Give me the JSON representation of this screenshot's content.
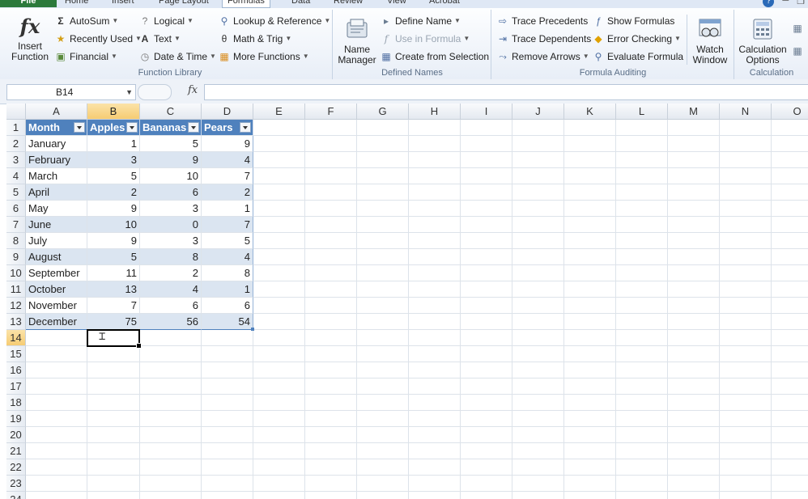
{
  "tabs": {
    "file": "File",
    "home": "Home",
    "insert": "Insert",
    "page_layout": "Page Layout",
    "formulas": "Formulas",
    "data": "Data",
    "review": "Review",
    "view": "View",
    "acrobat": "Acrobat"
  },
  "ribbon": {
    "function_library": {
      "label": "Function Library",
      "insert_function": "Insert Function",
      "autosum": "AutoSum",
      "recently_used": "Recently Used",
      "financial": "Financial",
      "logical": "Logical",
      "text": "Text",
      "date_time": "Date & Time",
      "lookup_reference": "Lookup & Reference",
      "math_trig": "Math & Trig",
      "more_functions": "More Functions"
    },
    "defined_names": {
      "label": "Defined Names",
      "name_manager": "Name Manager",
      "define_name": "Define Name",
      "use_in_formula": "Use in Formula",
      "create_from_selection": "Create from Selection"
    },
    "formula_auditing": {
      "label": "Formula Auditing",
      "trace_precedents": "Trace Precedents",
      "trace_dependents": "Trace Dependents",
      "remove_arrows": "Remove Arrows",
      "show_formulas": "Show Formulas",
      "error_checking": "Error Checking",
      "evaluate_formula": "Evaluate Formula",
      "watch_window": "Watch Window"
    },
    "calculation": {
      "label": "Calculation",
      "calculation_options": "Calculation Options"
    }
  },
  "formula_bar": {
    "name_box": "B14",
    "fx": "fx",
    "value": ""
  },
  "grid": {
    "columns": [
      "A",
      "B",
      "C",
      "D",
      "E",
      "F",
      "G",
      "H",
      "I",
      "J",
      "K",
      "L",
      "M",
      "N",
      "O"
    ],
    "selected_column": "B",
    "rows": [
      "1",
      "2",
      "3",
      "4",
      "5",
      "6",
      "7",
      "8",
      "9",
      "10",
      "11",
      "12",
      "13",
      "14",
      "15",
      "16",
      "17",
      "18",
      "19",
      "20",
      "21",
      "22",
      "23",
      "24"
    ],
    "selected_row": "14",
    "table": {
      "headers": [
        "Month",
        "Apples",
        "Bananas",
        "Pears"
      ],
      "rows": [
        [
          "January",
          "1",
          "5",
          "9"
        ],
        [
          "February",
          "3",
          "9",
          "4"
        ],
        [
          "March",
          "5",
          "10",
          "7"
        ],
        [
          "April",
          "2",
          "6",
          "2"
        ],
        [
          "May",
          "9",
          "3",
          "1"
        ],
        [
          "June",
          "10",
          "0",
          "7"
        ],
        [
          "July",
          "9",
          "3",
          "5"
        ],
        [
          "August",
          "5",
          "8",
          "4"
        ],
        [
          "September",
          "11",
          "2",
          "8"
        ],
        [
          "October",
          "13",
          "4",
          "1"
        ],
        [
          "November",
          "7",
          "6",
          "6"
        ],
        [
          "December",
          "75",
          "56",
          "54"
        ]
      ]
    }
  },
  "colors": {
    "table_header": "#4f81bd",
    "band": "#dbe5f1",
    "selected_header": "#f6cc73",
    "file_tab": "#2c7a3b"
  }
}
